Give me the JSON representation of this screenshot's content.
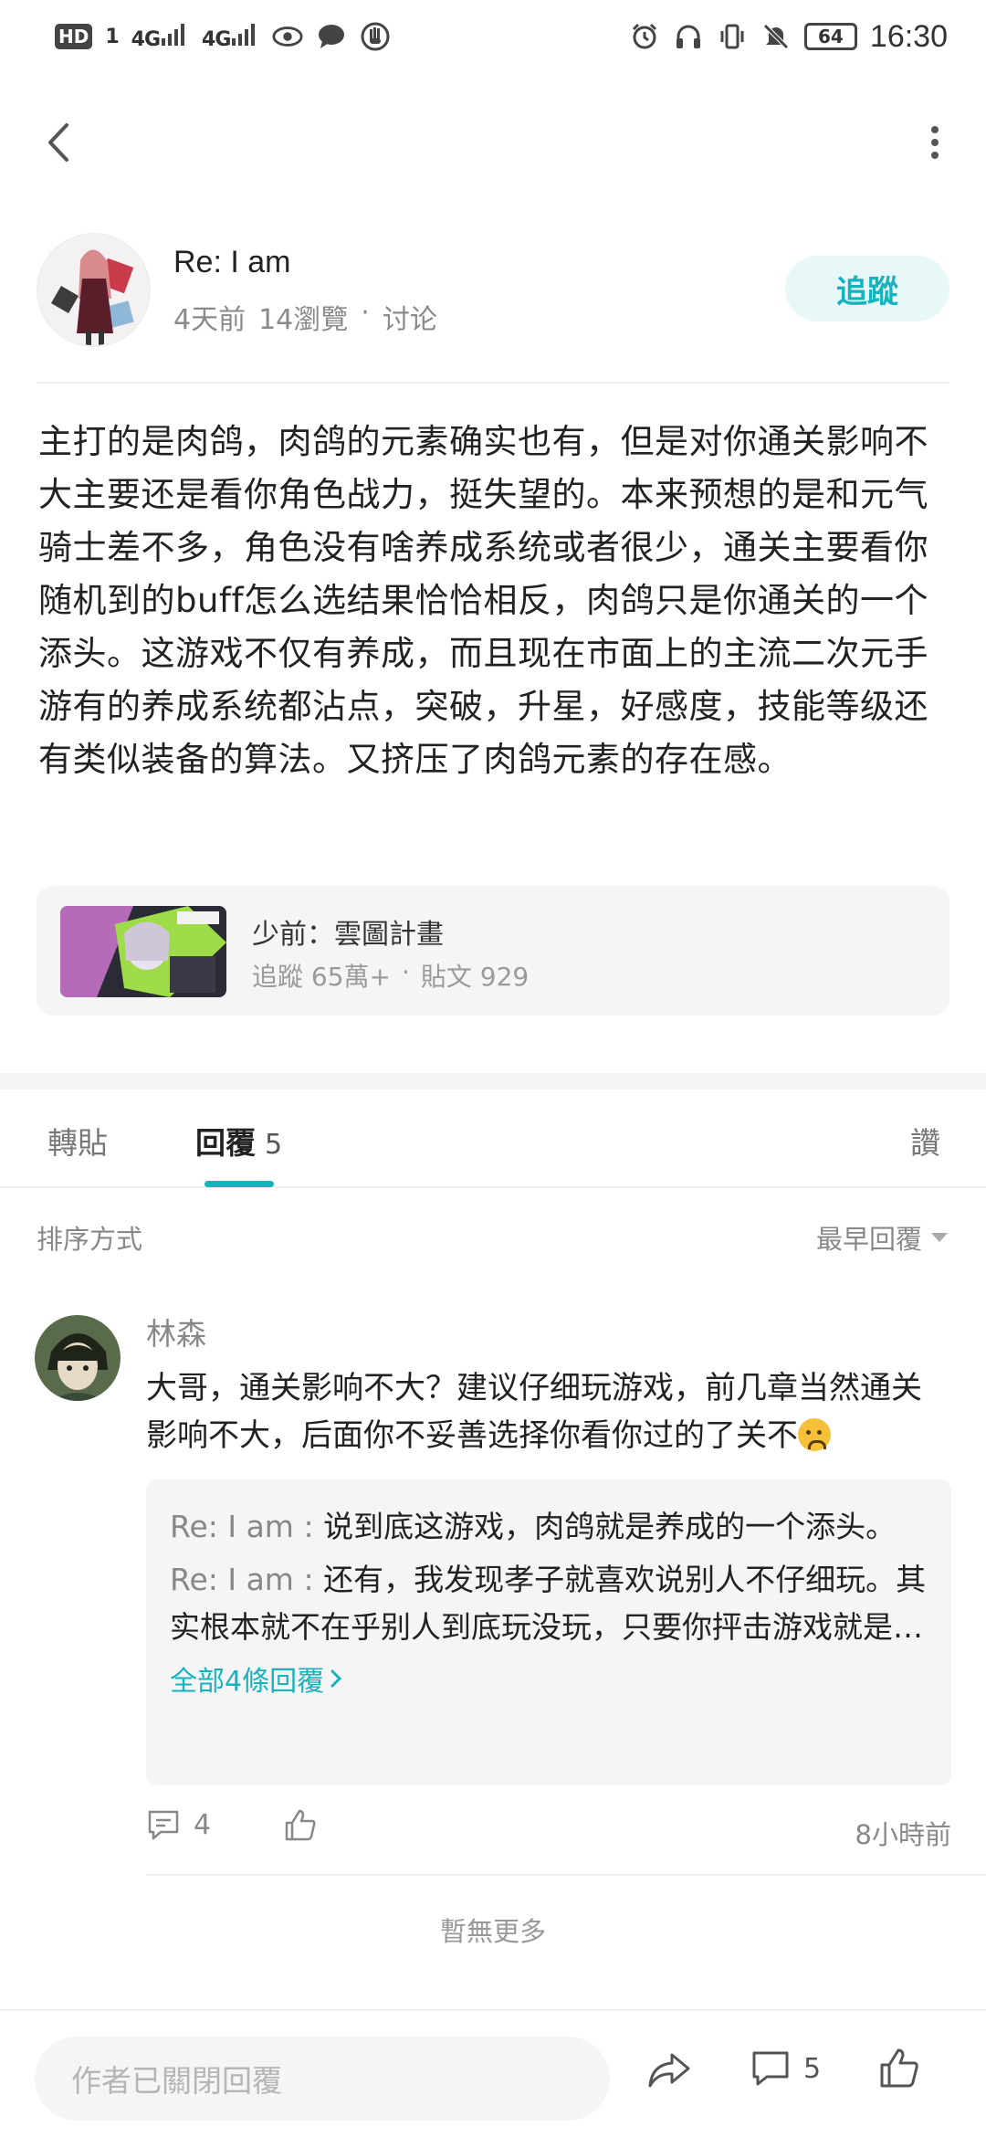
{
  "status_bar": {
    "hd_badge": "HD",
    "sim": "1",
    "signal1": "4G",
    "signal2": "4G",
    "battery": "64",
    "time": "16:30"
  },
  "post": {
    "author_name": "Re: I am",
    "time_ago": "4天前",
    "views": "14瀏覽",
    "dot": "·",
    "category": "讨论",
    "follow_label": "追蹤",
    "body": "主打的是肉鸽，肉鸽的元素确实也有，但是对你通关影响不大主要还是看你角色战力，挺失望的。本来预想的是和元气骑士差不多，角色没有啥养成系统或者很少，通关主要看你随机到的buff怎么选结果恰恰相反，肉鸽只是你通关的一个添头。这游戏不仅有养成，而且现在市面上的主流二次元手游有的养成系统都沾点，突破，升星，好感度，技能等级还有类似装备的算法。又挤压了肉鸽元素的存在感。"
  },
  "game_card": {
    "title": "少前：雲圖計畫",
    "followers": "追蹤 65萬+",
    "dot": "·",
    "posts": "貼文 929"
  },
  "tabs": {
    "repost": "轉貼",
    "reply": "回覆",
    "reply_count": "5",
    "like": "讚"
  },
  "sort": {
    "label": "排序方式",
    "value": "最早回覆"
  },
  "reply": {
    "name": "林森",
    "text": "大哥，通关影响不大？建议仔细玩游戏，前几章当然通关影响不大，后面你不妥善选择你看你过的了关不",
    "sub_replies": [
      {
        "name": "Re: I am",
        "sep": " : ",
        "text": "说到底这游戏，肉鸽就是养成的一个添头。"
      },
      {
        "name": "Re: I am",
        "sep": " : ",
        "text": "还有，我发现孝子就喜欢说别人不仔细玩。其实根本就不在乎别人到底玩没玩，只要你抨击游戏就是不仔细玩"
      }
    ],
    "all_replies": "全部4條回覆",
    "comment_count": "4",
    "time": "8小時前"
  },
  "no_more": "暫無更多",
  "bottom_bar": {
    "input_placeholder": "作者已關閉回覆",
    "comment_count": "5"
  },
  "colors": {
    "accent": "#16b3bf",
    "follow_bg": "#e8f7f8",
    "card_bg": "#f5f5f6"
  }
}
